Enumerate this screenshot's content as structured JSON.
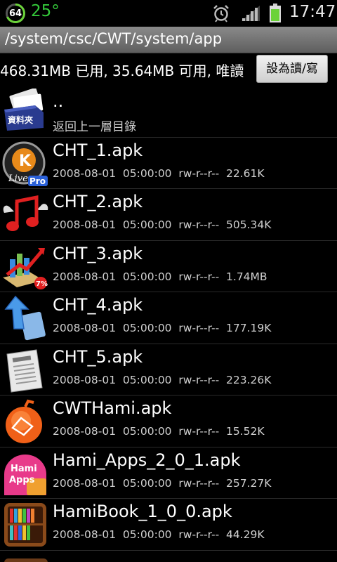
{
  "status": {
    "battery_level": "64",
    "temperature": "25°",
    "time": "17:47",
    "icons": [
      "battery-circle-icon",
      "alarm-clock-icon",
      "signal-icon",
      "battery-icon"
    ]
  },
  "path": "/system/csc/CWT/system/app",
  "storage_info": "468.31MB 已用, 35.64MB 可用, 唯讀",
  "rw_button_label": "設為讀/寫",
  "parent_dir": {
    "name": "..",
    "label": "返回上一層目錄",
    "icon_text": "資料夾"
  },
  "files": [
    {
      "name": "CHT_1.apk",
      "meta": "2008-08-01  05:00:00  rw-r--r--  22.61K",
      "icon": "kkbox-live-icon",
      "icon_text": "Pro"
    },
    {
      "name": "CHT_2.apk",
      "meta": "2008-08-01  05:00:00  rw-r--r--  505.34K",
      "icon": "music-note-icon"
    },
    {
      "name": "CHT_3.apk",
      "meta": "2008-08-01  05:00:00  rw-r--r--  1.74MB",
      "icon": "stock-chart-icon",
      "icon_text": "7%"
    },
    {
      "name": "CHT_4.apk",
      "meta": "2008-08-01  05:00:00  rw-r--r--  177.19K",
      "icon": "arrow-tablet-icon"
    },
    {
      "name": "CHT_5.apk",
      "meta": "2008-08-01  05:00:00  rw-r--r--  223.26K",
      "icon": "newspaper-icon"
    },
    {
      "name": "CWTHami.apk",
      "meta": "2008-08-01  05:00:00  rw-r--r--  15.52K",
      "icon": "hami-orange-icon"
    },
    {
      "name": "Hami_Apps_2_0_1.apk",
      "meta": "2008-08-01  05:00:00  rw-r--r--  257.27K",
      "icon": "hami-apps-icon",
      "icon_text": "Hami Apps"
    },
    {
      "name": "HamiBook_1_0_0.apk",
      "meta": "2008-08-01  05:00:00  rw-r--r--  44.29K",
      "icon": "bookshelf-icon"
    }
  ],
  "colors": {
    "temperature": "#34c83a",
    "battery": "#6bd23a",
    "header_bg": "#777777",
    "divider": "#2a2a2a"
  }
}
